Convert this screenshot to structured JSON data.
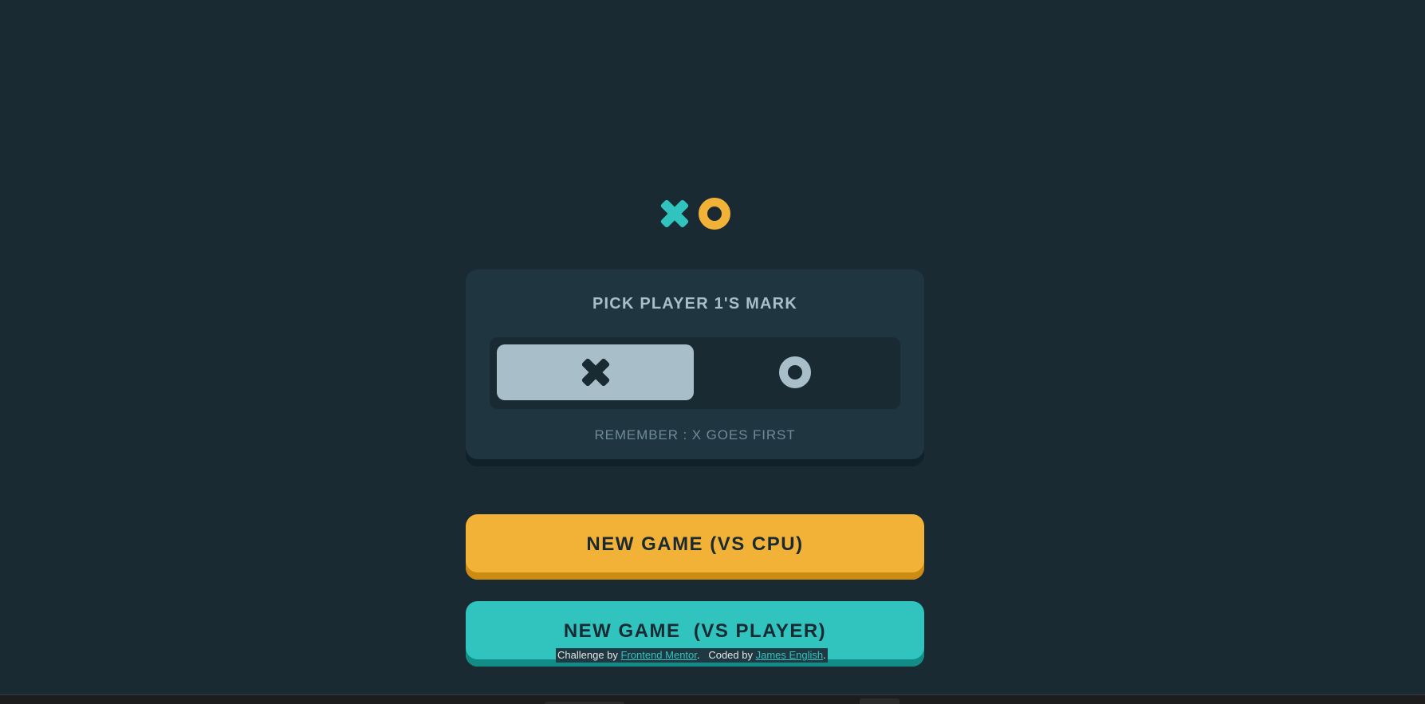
{
  "logo": {
    "icons": [
      "x-mark-icon",
      "o-mark-icon"
    ]
  },
  "mark_picker": {
    "title": "PICK PLAYER 1'S MARK",
    "options": [
      {
        "icon": "x-mark-icon",
        "selected": true
      },
      {
        "icon": "o-mark-icon",
        "selected": false
      }
    ],
    "hint": "REMEMBER : X GOES FIRST"
  },
  "buttons": {
    "vs_cpu": "NEW GAME (VS CPU)",
    "vs_player": "NEW GAME  (VS PLAYER)"
  },
  "attribution": {
    "prefix": "Challenge by ",
    "challenge_link": "Frontend Mentor",
    "middle": ".   Coded by ",
    "author_link": "James English",
    "suffix": "."
  },
  "colors": {
    "background": "#1a2a33",
    "card": "#1f3641",
    "silver": "#a8bfc9",
    "yellow": "#f2b137",
    "teal": "#31c3bd"
  }
}
